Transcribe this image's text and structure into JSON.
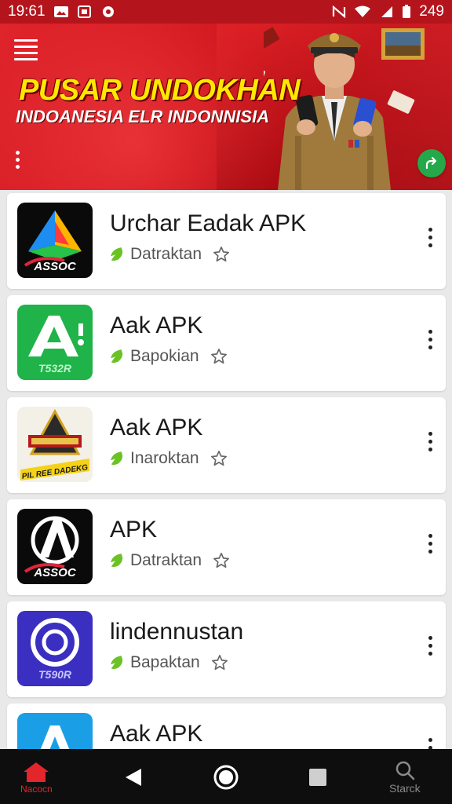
{
  "status_bar": {
    "time": "19:61",
    "battery": "249"
  },
  "banner": {
    "title": "PUSAR UNDOKHAN",
    "subtitle": "INDOANESIA ELR INDONNISIA"
  },
  "apps": [
    {
      "name": "Urchar Eadak APK",
      "category": "Datraktan",
      "icon": "app-icon-prism-assoc",
      "icon_text": "ASSOC"
    },
    {
      "name": "Aak APK",
      "category": "Bapokian",
      "icon": "app-icon-green-a",
      "icon_text": "T532R"
    },
    {
      "name": "Aak APK",
      "category": "Inaroktan",
      "icon": "app-icon-gold-emblem",
      "icon_text": "PIL REE DADEKG"
    },
    {
      "name": "APK",
      "category": "Datraktan",
      "icon": "app-icon-black-a-assoc",
      "icon_text": "ASSOC"
    },
    {
      "name": "lindennustan",
      "category": "Bapaktan",
      "icon": "app-icon-blue-ring",
      "icon_text": "T590R"
    },
    {
      "name": "Aak APK",
      "category": "",
      "icon": "app-icon-cyan-a",
      "icon_text": ""
    }
  ],
  "bottom_nav": {
    "home_label": "Nacocn",
    "search_label": "Starck"
  },
  "colors": {
    "banner_red": "#d0161e",
    "title_yellow": "#ffe800",
    "verified_green": "#6cc224",
    "nav_active": "#e3262b",
    "fab_green": "#25a84a"
  }
}
